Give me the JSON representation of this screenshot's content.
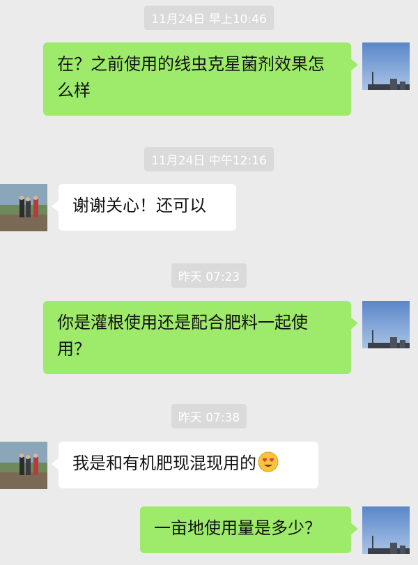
{
  "colors": {
    "background": "#ebebeb",
    "sent_bubble": "#9eea6a",
    "received_bubble": "#ffffff",
    "timestamp_bg": "#dadada"
  },
  "messages": [
    {
      "timestamp": "11月24日 早上10:46",
      "sender": "me",
      "text": "在？之前使用的线虫克星菌剂效果怎么样"
    },
    {
      "timestamp": "11月24日 中午12:16",
      "sender": "other",
      "text": "谢谢关心！还可以"
    },
    {
      "timestamp": "昨天 07:23",
      "sender": "me",
      "text": "你是灌根使用还是配合肥料一起使用？"
    },
    {
      "timestamp": "昨天 07:38",
      "sender": "other",
      "text": "我是和有机肥现混现用的",
      "emoji": "heart-eyes-emoji"
    },
    {
      "sender": "me",
      "text": "一亩地使用量是多少？"
    }
  ]
}
